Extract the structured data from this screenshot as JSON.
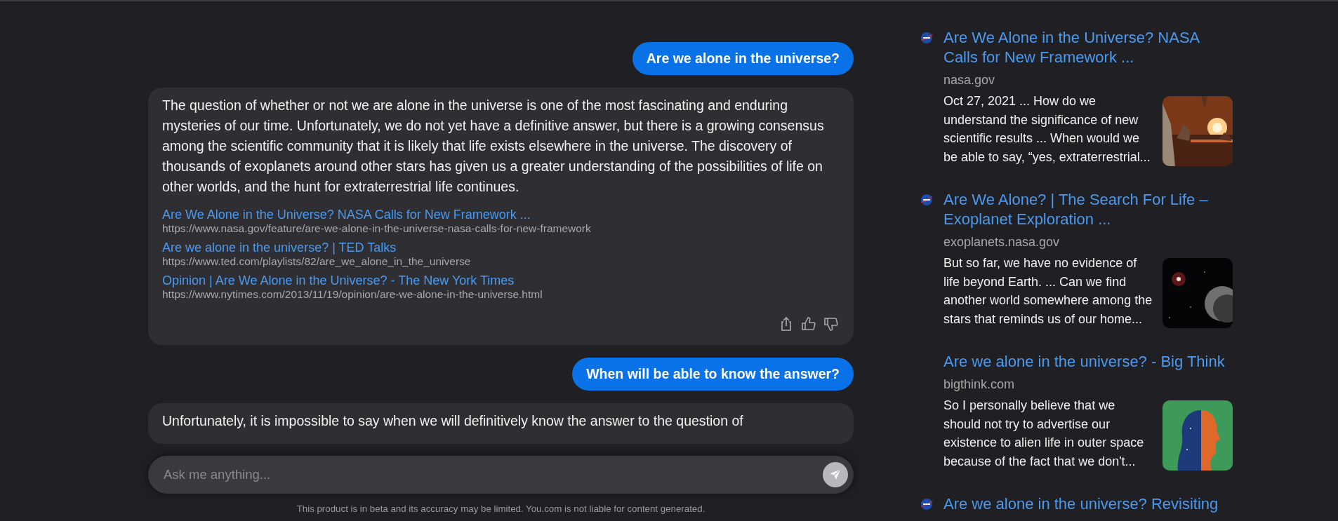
{
  "chat": {
    "messages": [
      {
        "kind": "user",
        "text": "Are we alone in the universe?"
      },
      {
        "kind": "assistant",
        "text": "The question of whether or not we are alone in the universe is one of the most fascinating and enduring mysteries of our time. Unfortunately, we do not yet have a definitive answer, but there is a growing consensus among the scientific community that it is likely that life exists elsewhere in the universe. The discovery of thousands of exoplanets around other stars has given us a greater understanding of the possibilities of life on other worlds, and the hunt for extraterrestrial life continues.",
        "sources": [
          {
            "title": "Are We Alone in the Universe? NASA Calls for New Framework ...",
            "url": "https://www.nasa.gov/feature/are-we-alone-in-the-universe-nasa-calls-for-new-framework"
          },
          {
            "title": "Are we alone in the universe? | TED Talks",
            "url": "https://www.ted.com/playlists/82/are_we_alone_in_the_universe"
          },
          {
            "title": "Opinion | Are We Alone in the Universe? - The New York Times",
            "url": "https://www.nytimes.com/2013/11/19/opinion/are-we-alone-in-the-universe.html"
          }
        ],
        "actions": true
      },
      {
        "kind": "user",
        "text": "When will be able to know the answer?"
      },
      {
        "kind": "assistant",
        "text": "Unfortunately, it is impossible to say when we will definitively know the answer to the question of",
        "actions": false
      }
    ],
    "input": {
      "placeholder": "Ask me anything..."
    },
    "disclaimer": "This product is in beta and its accuracy may be limited. You.com is not liable for content generated."
  },
  "results": [
    {
      "icon": true,
      "title": "Are We Alone in the Universe? NASA Calls for New Framework ...",
      "domain": "nasa.gov",
      "snippet": "Oct 27, 2021 ... How do we understand the significance of new scientific results ... When would we be able to say, “yes, extraterrestrial..."
    },
    {
      "icon": true,
      "title": "Are We Alone? | The Search For Life – Exoplanet Exploration ...",
      "domain": "exoplanets.nasa.gov",
      "snippet": "But so far, we have no evidence of life beyond Earth. ... Can we find another world somewhere among the stars that reminds us of our home..."
    },
    {
      "icon": false,
      "title": "Are we alone in the universe? - Big Think",
      "domain": "bigthink.com",
      "snippet": "So I personally believe that we should not try to advertise our existence to alien life in outer space because of the fact that we don't..."
    },
    {
      "icon": true,
      "title": "Are we alone in the universe? Revisiting"
    }
  ]
}
